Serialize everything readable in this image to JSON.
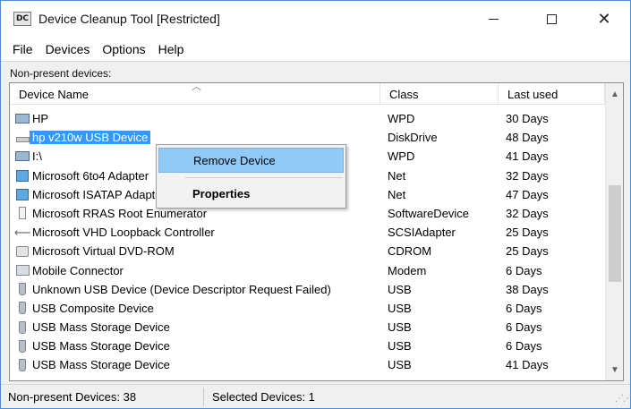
{
  "window": {
    "app_icon_text": "DC",
    "title": "Device Cleanup Tool  [Restricted]"
  },
  "menu": [
    "File",
    "Devices",
    "Options",
    "Help"
  ],
  "section_label": "Non-present devices:",
  "columns": {
    "name": "Device Name",
    "class": "Class",
    "last_used": "Last used"
  },
  "devices": [
    {
      "name": "HP",
      "class": "WPD",
      "last": "30 Days",
      "icon": "portable-device-icon"
    },
    {
      "name": "hp v210w USB Device",
      "class": "DiskDrive",
      "last": "48 Days",
      "icon": "disk-drive-icon",
      "selected": true
    },
    {
      "name": "I:\\",
      "class": "WPD",
      "last": "41 Days",
      "icon": "portable-device-icon"
    },
    {
      "name": "Microsoft 6to4 Adapter",
      "class": "Net",
      "last": "32 Days",
      "icon": "network-adapter-icon"
    },
    {
      "name": "Microsoft ISATAP Adapter",
      "class": "Net",
      "last": "47 Days",
      "icon": "network-adapter-icon"
    },
    {
      "name": "Microsoft RRAS Root Enumerator",
      "class": "SoftwareDevice",
      "last": "32 Days",
      "icon": "software-device-icon"
    },
    {
      "name": "Microsoft VHD Loopback Controller",
      "class": "SCSIAdapter",
      "last": "25 Days",
      "icon": "scsi-adapter-icon"
    },
    {
      "name": "Microsoft Virtual DVD-ROM",
      "class": "CDROM",
      "last": "25 Days",
      "icon": "cdrom-icon"
    },
    {
      "name": "Mobile Connector",
      "class": "Modem",
      "last": "6 Days",
      "icon": "modem-icon"
    },
    {
      "name": "Unknown USB Device (Device Descriptor Request Failed)",
      "class": "USB",
      "last": "38 Days",
      "icon": "usb-icon"
    },
    {
      "name": "USB Composite Device",
      "class": "USB",
      "last": "6 Days",
      "icon": "usb-icon"
    },
    {
      "name": "USB Mass Storage Device",
      "class": "USB",
      "last": "6 Days",
      "icon": "usb-icon"
    },
    {
      "name": "USB Mass Storage Device",
      "class": "USB",
      "last": "6 Days",
      "icon": "usb-icon"
    },
    {
      "name": "USB Mass Storage Device",
      "class": "USB",
      "last": "41 Days",
      "icon": "usb-icon"
    }
  ],
  "context_menu": {
    "remove": "Remove Device",
    "properties": "Properties"
  },
  "status": {
    "left": "Non-present Devices: 38",
    "right": "Selected Devices: 1"
  },
  "colors": {
    "selection": "#3399ff",
    "menu_highlight": "#91c9f7"
  }
}
